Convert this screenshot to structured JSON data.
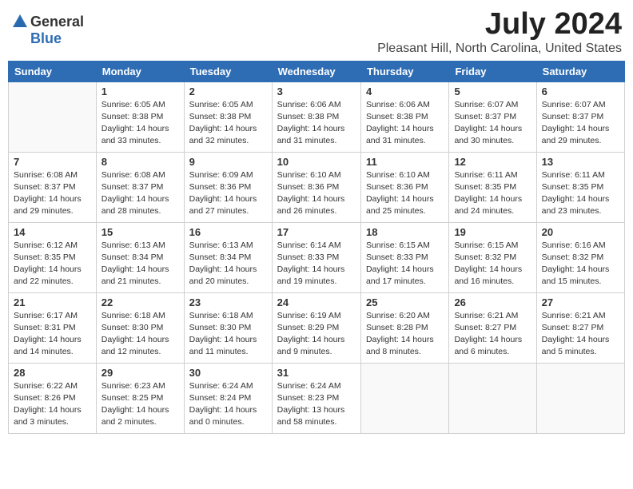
{
  "header": {
    "logo_general": "General",
    "logo_blue": "Blue",
    "title": "July 2024",
    "location": "Pleasant Hill, North Carolina, United States"
  },
  "calendar": {
    "weekdays": [
      "Sunday",
      "Monday",
      "Tuesday",
      "Wednesday",
      "Thursday",
      "Friday",
      "Saturday"
    ],
    "weeks": [
      [
        {
          "day": "",
          "info": ""
        },
        {
          "day": "1",
          "info": "Sunrise: 6:05 AM\nSunset: 8:38 PM\nDaylight: 14 hours\nand 33 minutes."
        },
        {
          "day": "2",
          "info": "Sunrise: 6:05 AM\nSunset: 8:38 PM\nDaylight: 14 hours\nand 32 minutes."
        },
        {
          "day": "3",
          "info": "Sunrise: 6:06 AM\nSunset: 8:38 PM\nDaylight: 14 hours\nand 31 minutes."
        },
        {
          "day": "4",
          "info": "Sunrise: 6:06 AM\nSunset: 8:38 PM\nDaylight: 14 hours\nand 31 minutes."
        },
        {
          "day": "5",
          "info": "Sunrise: 6:07 AM\nSunset: 8:37 PM\nDaylight: 14 hours\nand 30 minutes."
        },
        {
          "day": "6",
          "info": "Sunrise: 6:07 AM\nSunset: 8:37 PM\nDaylight: 14 hours\nand 29 minutes."
        }
      ],
      [
        {
          "day": "7",
          "info": "Sunrise: 6:08 AM\nSunset: 8:37 PM\nDaylight: 14 hours\nand 29 minutes."
        },
        {
          "day": "8",
          "info": "Sunrise: 6:08 AM\nSunset: 8:37 PM\nDaylight: 14 hours\nand 28 minutes."
        },
        {
          "day": "9",
          "info": "Sunrise: 6:09 AM\nSunset: 8:36 PM\nDaylight: 14 hours\nand 27 minutes."
        },
        {
          "day": "10",
          "info": "Sunrise: 6:10 AM\nSunset: 8:36 PM\nDaylight: 14 hours\nand 26 minutes."
        },
        {
          "day": "11",
          "info": "Sunrise: 6:10 AM\nSunset: 8:36 PM\nDaylight: 14 hours\nand 25 minutes."
        },
        {
          "day": "12",
          "info": "Sunrise: 6:11 AM\nSunset: 8:35 PM\nDaylight: 14 hours\nand 24 minutes."
        },
        {
          "day": "13",
          "info": "Sunrise: 6:11 AM\nSunset: 8:35 PM\nDaylight: 14 hours\nand 23 minutes."
        }
      ],
      [
        {
          "day": "14",
          "info": "Sunrise: 6:12 AM\nSunset: 8:35 PM\nDaylight: 14 hours\nand 22 minutes."
        },
        {
          "day": "15",
          "info": "Sunrise: 6:13 AM\nSunset: 8:34 PM\nDaylight: 14 hours\nand 21 minutes."
        },
        {
          "day": "16",
          "info": "Sunrise: 6:13 AM\nSunset: 8:34 PM\nDaylight: 14 hours\nand 20 minutes."
        },
        {
          "day": "17",
          "info": "Sunrise: 6:14 AM\nSunset: 8:33 PM\nDaylight: 14 hours\nand 19 minutes."
        },
        {
          "day": "18",
          "info": "Sunrise: 6:15 AM\nSunset: 8:33 PM\nDaylight: 14 hours\nand 17 minutes."
        },
        {
          "day": "19",
          "info": "Sunrise: 6:15 AM\nSunset: 8:32 PM\nDaylight: 14 hours\nand 16 minutes."
        },
        {
          "day": "20",
          "info": "Sunrise: 6:16 AM\nSunset: 8:32 PM\nDaylight: 14 hours\nand 15 minutes."
        }
      ],
      [
        {
          "day": "21",
          "info": "Sunrise: 6:17 AM\nSunset: 8:31 PM\nDaylight: 14 hours\nand 14 minutes."
        },
        {
          "day": "22",
          "info": "Sunrise: 6:18 AM\nSunset: 8:30 PM\nDaylight: 14 hours\nand 12 minutes."
        },
        {
          "day": "23",
          "info": "Sunrise: 6:18 AM\nSunset: 8:30 PM\nDaylight: 14 hours\nand 11 minutes."
        },
        {
          "day": "24",
          "info": "Sunrise: 6:19 AM\nSunset: 8:29 PM\nDaylight: 14 hours\nand 9 minutes."
        },
        {
          "day": "25",
          "info": "Sunrise: 6:20 AM\nSunset: 8:28 PM\nDaylight: 14 hours\nand 8 minutes."
        },
        {
          "day": "26",
          "info": "Sunrise: 6:21 AM\nSunset: 8:27 PM\nDaylight: 14 hours\nand 6 minutes."
        },
        {
          "day": "27",
          "info": "Sunrise: 6:21 AM\nSunset: 8:27 PM\nDaylight: 14 hours\nand 5 minutes."
        }
      ],
      [
        {
          "day": "28",
          "info": "Sunrise: 6:22 AM\nSunset: 8:26 PM\nDaylight: 14 hours\nand 3 minutes."
        },
        {
          "day": "29",
          "info": "Sunrise: 6:23 AM\nSunset: 8:25 PM\nDaylight: 14 hours\nand 2 minutes."
        },
        {
          "day": "30",
          "info": "Sunrise: 6:24 AM\nSunset: 8:24 PM\nDaylight: 14 hours\nand 0 minutes."
        },
        {
          "day": "31",
          "info": "Sunrise: 6:24 AM\nSunset: 8:23 PM\nDaylight: 13 hours\nand 58 minutes."
        },
        {
          "day": "",
          "info": ""
        },
        {
          "day": "",
          "info": ""
        },
        {
          "day": "",
          "info": ""
        }
      ]
    ]
  }
}
